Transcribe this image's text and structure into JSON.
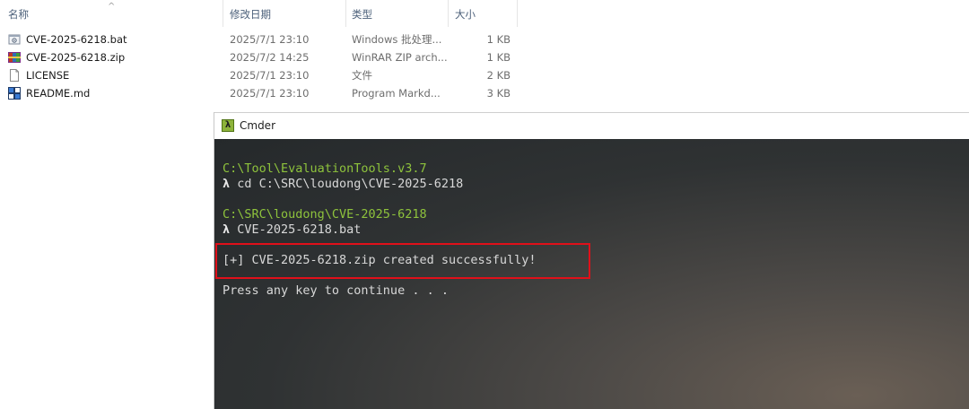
{
  "explorer": {
    "columns": {
      "name": "名称",
      "date": "修改日期",
      "type": "类型",
      "size": "大小"
    },
    "sort_indicator": "^",
    "files": [
      {
        "name": "CVE-2025-6218.bat",
        "date": "2025/7/1 23:10",
        "type": "Windows 批处理...",
        "size": "1 KB",
        "icon": "bat-file-icon"
      },
      {
        "name": "CVE-2025-6218.zip",
        "date": "2025/7/2 14:25",
        "type": "WinRAR ZIP arch...",
        "size": "1 KB",
        "icon": "winrar-zip-icon"
      },
      {
        "name": "LICENSE",
        "date": "2025/7/1 23:10",
        "type": "文件",
        "size": "2 KB",
        "icon": "blank-file-icon"
      },
      {
        "name": "README.md",
        "date": "2025/7/1 23:10",
        "type": "Program Markd...",
        "size": "3 KB",
        "icon": "markdown-file-icon"
      }
    ]
  },
  "cmder": {
    "title": "Cmder",
    "icon_glyph": "λ",
    "lines": {
      "path1": "C:\\Tool\\EvaluationTools.v3.7",
      "cmd1_prompt": "λ",
      "cmd1": " cd C:\\SRC\\loudong\\CVE-2025-6218",
      "path2": "C:\\SRC\\loudong\\CVE-2025-6218",
      "cmd2_prompt": "λ",
      "cmd2": " CVE-2025-6218.bat",
      "output": "[+] CVE-2025-6218.zip created successfully!",
      "pause": "Press any key to continue . . ."
    },
    "colors": {
      "path": "#8ec33c",
      "highlight_border": "#e0101a"
    }
  }
}
